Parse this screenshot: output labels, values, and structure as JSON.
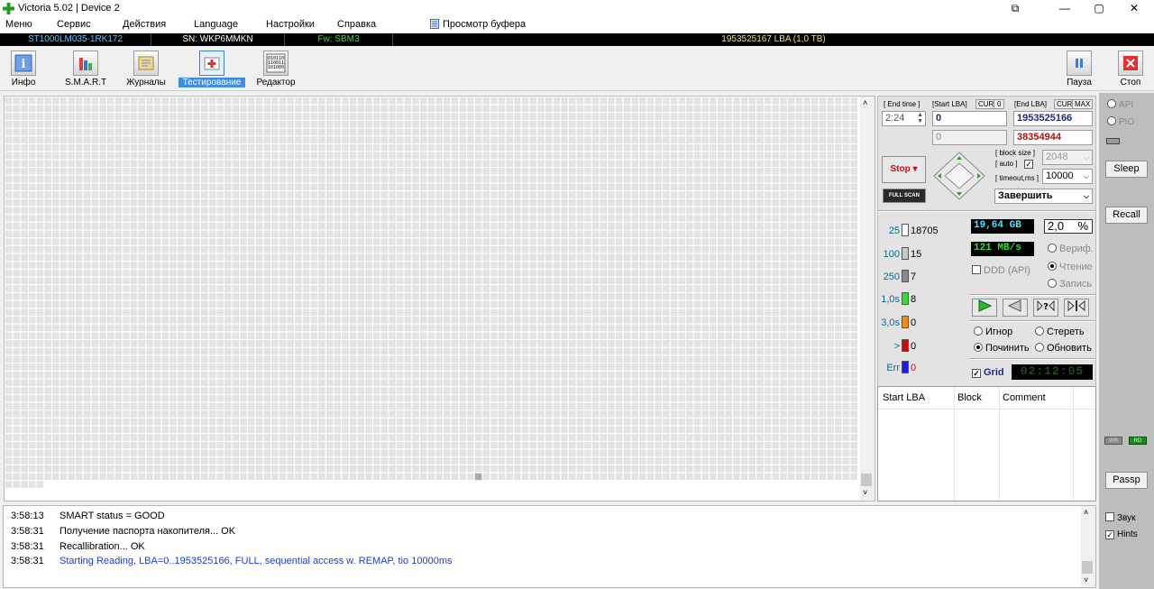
{
  "window": {
    "title": "Victoria 5.02 | Device 2"
  },
  "menu": {
    "items": [
      "Меню",
      "Сервис",
      "Действия",
      "Language",
      "Настройки",
      "Справка"
    ],
    "buffer_view": "Просмотр буфера"
  },
  "drive": {
    "model": "ST1000LM035-1RK172",
    "serial": "SN: WKP6MMKN",
    "firmware": "Fw: SBM3",
    "capacity": "1953525167 LBA (1,0 TB)"
  },
  "toolbar": {
    "tabs": [
      {
        "label": "Инфо",
        "icon": "info-icon"
      },
      {
        "label": "S.M.A.R.T",
        "icon": "smart-icon"
      },
      {
        "label": "Журналы",
        "icon": "logs-icon"
      },
      {
        "label": "Тестирование",
        "icon": "testing-icon",
        "active": true
      },
      {
        "label": "Редактор",
        "icon": "editor-icon"
      }
    ],
    "pause_label": "Пауза",
    "stop_label": "Стоп"
  },
  "scan": {
    "end_time_label": "[ End time ]",
    "end_time_value": "2:24",
    "start_lba_label": "[Start LBA]",
    "end_lba_label": "[End LBA]",
    "cur_label": "CUR",
    "zero_label": "0",
    "max_label": "MAX",
    "start_lba": "0",
    "end_lba": "1953525166",
    "current_lba": "0",
    "position_lba": "38354944",
    "block_size_label": "[ block size ]",
    "auto_label": "[ auto ]",
    "timeout_label": "[ timeout,ms ]",
    "block_size": "2048",
    "timeout": "10000",
    "stop_button": "Stop",
    "full_scan_button": "FULL SCAN",
    "finish_action": "Завершить"
  },
  "stats": {
    "legend": [
      {
        "label": "25",
        "count": "18705",
        "color": "#ffffff"
      },
      {
        "label": "100",
        "count": "15",
        "color": "#c8c8c8"
      },
      {
        "label": "250",
        "count": "7",
        "color": "#8a8a8a"
      },
      {
        "label": "1,0s",
        "count": "8",
        "color": "#2ee02e"
      },
      {
        "label": "3,0s",
        "count": "0",
        "color": "#ff8c00"
      },
      {
        "label": ">",
        "count": "0",
        "color": "#e00000"
      },
      {
        "label": "Err",
        "count": "0",
        "color": "#1a1aff"
      }
    ],
    "scanned": "19,64 GB",
    "percent": "2,0",
    "percent_sign": "%",
    "speed": "121 MB/s",
    "ddd_label": "DDD (API)",
    "modes": [
      "Вериф.",
      "Чтение",
      "Запись"
    ],
    "selected_mode": "Чтение",
    "repair_modes": [
      "Игнор",
      "Стереть",
      "Починить",
      "Обновить"
    ],
    "selected_repair": "Починить",
    "grid_label": "Grid",
    "timer": "02:12:05"
  },
  "table": {
    "columns": [
      "Start LBA",
      "Block",
      "Comment"
    ]
  },
  "log": [
    {
      "time": "3:58:13",
      "text": "SMART status = GOOD",
      "color": "#000000"
    },
    {
      "time": "3:58:31",
      "text": "Получение паспорта накопителя... OK",
      "color": "#000000"
    },
    {
      "time": "3:58:31",
      "text": "Recallibration... OK",
      "color": "#000000"
    },
    {
      "time": "3:58:31",
      "text": "Starting Reading, LBA=0..1953525166, FULL, sequential access w. REMAP, tio 10000ms",
      "color": "#1a3fd6"
    }
  ],
  "right_panel": {
    "api_label": "API",
    "pio_label": "PIO",
    "sleep_label": "Sleep",
    "recall_label": "Recall",
    "wr_label": "WR",
    "rd_label": "RD",
    "passp_label": "Passp",
    "sound_label": "Звук",
    "hints_label": "Hints"
  },
  "grid": {
    "progress_fraction": 0.981
  }
}
